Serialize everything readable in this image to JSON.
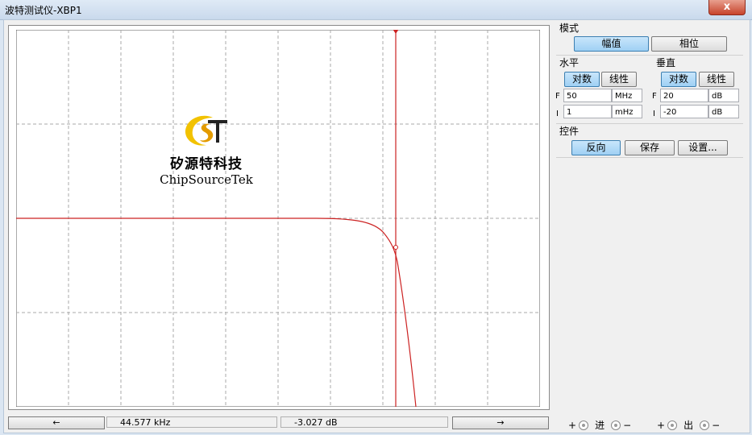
{
  "window": {
    "title": "波特测试仪-XBP1",
    "close": "x"
  },
  "logo": {
    "name_cn": "矽源特科技",
    "name_en": "ChipSourceTek"
  },
  "mode": {
    "label": "模式",
    "magnitude": "幅值",
    "phase": "相位",
    "selected": "幅值"
  },
  "horizontal": {
    "label": "水平",
    "log": "对数",
    "lin": "线性",
    "selected": "对数",
    "f_label": "F",
    "f_value": "50",
    "f_unit": "MHz",
    "i_label": "I",
    "i_value": "1",
    "i_unit": "mHz"
  },
  "vertical": {
    "label": "垂直",
    "log": "对数",
    "lin": "线性",
    "selected": "对数",
    "f_label": "F",
    "f_value": "20",
    "f_unit": "dB",
    "i_label": "I",
    "i_value": "-20",
    "i_unit": "dB"
  },
  "controls": {
    "label": "控件",
    "reverse": "反向",
    "save": "保存",
    "settings": "设置..."
  },
  "readout": {
    "left_arrow": "←",
    "right_arrow": "→",
    "frequency": "44.577 kHz",
    "gain": "-3.027 dB"
  },
  "terminals": {
    "in": {
      "plus": "+",
      "label": "进",
      "minus": "−"
    },
    "out": {
      "plus": "+",
      "label": "出",
      "minus": "−"
    }
  },
  "colors": {
    "trace": "#cc2222",
    "cursor": "#cc2222",
    "grid": "#aaaaaa",
    "plot_bg": "#ffffff"
  }
}
